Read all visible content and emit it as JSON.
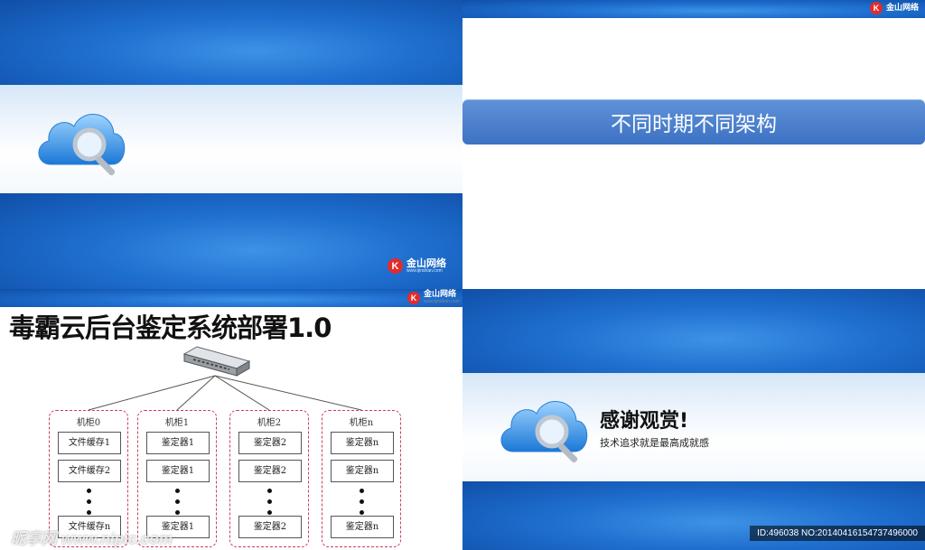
{
  "brand": {
    "name": "金山网络",
    "url": "www.ijinshan.com",
    "logo_letter": "K"
  },
  "slide_architecture": {
    "title": "不同时期不同架构"
  },
  "slide_diagram": {
    "title": "毒霸云后台鉴定系统部署1.0",
    "racks": [
      {
        "label": "机柜0",
        "boxes": [
          "文件缓存1",
          "文件缓存2",
          "文件缓存n"
        ]
      },
      {
        "label": "机柜1",
        "boxes": [
          "鉴定器1",
          "鉴定器1",
          "鉴定器1"
        ]
      },
      {
        "label": "机柜2",
        "boxes": [
          "鉴定器2",
          "鉴定器2",
          "鉴定器2"
        ]
      },
      {
        "label": "机柜n",
        "boxes": [
          "鉴定器n",
          "鉴定器n",
          "鉴定器n"
        ]
      }
    ]
  },
  "slide_thanks": {
    "heading": "感谢观赏!",
    "subtitle": "技术追求就是最高成就感"
  },
  "watermark": {
    "id_text": "ID:496038 NO:20140416154737496000",
    "site_text": "昵享网 www.nipic.com"
  },
  "colors": {
    "brand_blue": "#1f6fcf",
    "title_bar": "#4a7fcc",
    "rack_border": "#d23b56",
    "logo_red": "#e32b2b"
  }
}
